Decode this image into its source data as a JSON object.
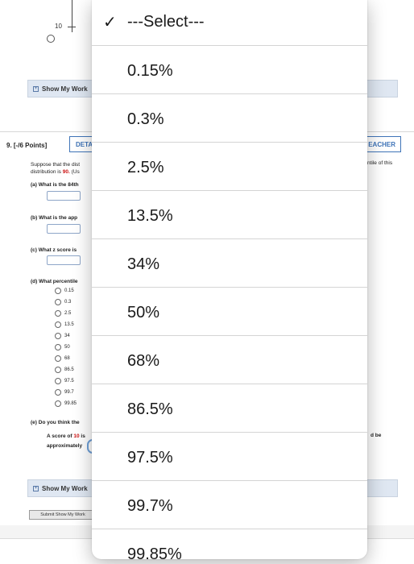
{
  "graph": {
    "tick_label": "10"
  },
  "show_my_work_top": {
    "label": "Show My Work"
  },
  "question": {
    "number": "9. [-/6 Points]",
    "details_label": "DETA",
    "teacher_label": "EACHER",
    "prompt_line1": "Suppose that the dist",
    "prompt_right": "ntile of this",
    "prompt_line2_pre": "distribution is ",
    "prompt_line2_value": "90.",
    "prompt_line2_post": " (Us",
    "part_a": "(a)   What is the 84th",
    "part_b": "(b)   What is the app",
    "part_c": "(c)   What z score is",
    "part_d": "(d)   What percentile",
    "options": [
      "0.15",
      "0.3",
      "2.5",
      "13.5",
      "34",
      "50",
      "68",
      "86.5",
      "97.5",
      "99.7",
      "99.85"
    ],
    "part_e": "(e)   Do you think the",
    "part_e_right": "d be",
    "score_line_pre": "A score of ",
    "score_line_value": "10",
    "score_line_post": " is",
    "approx_label": "approximately"
  },
  "show_my_work_bottom": {
    "label": "Show My Work"
  },
  "submit_label": "Submit Show My Work",
  "dropdown": {
    "selected": "---Select---",
    "check_glyph": "✓",
    "items": [
      "---Select---",
      "0.15%",
      "0.3%",
      "2.5%",
      "13.5%",
      "34%",
      "50%",
      "68%",
      "86.5%",
      "97.5%",
      "99.7%",
      "99.85%"
    ]
  }
}
